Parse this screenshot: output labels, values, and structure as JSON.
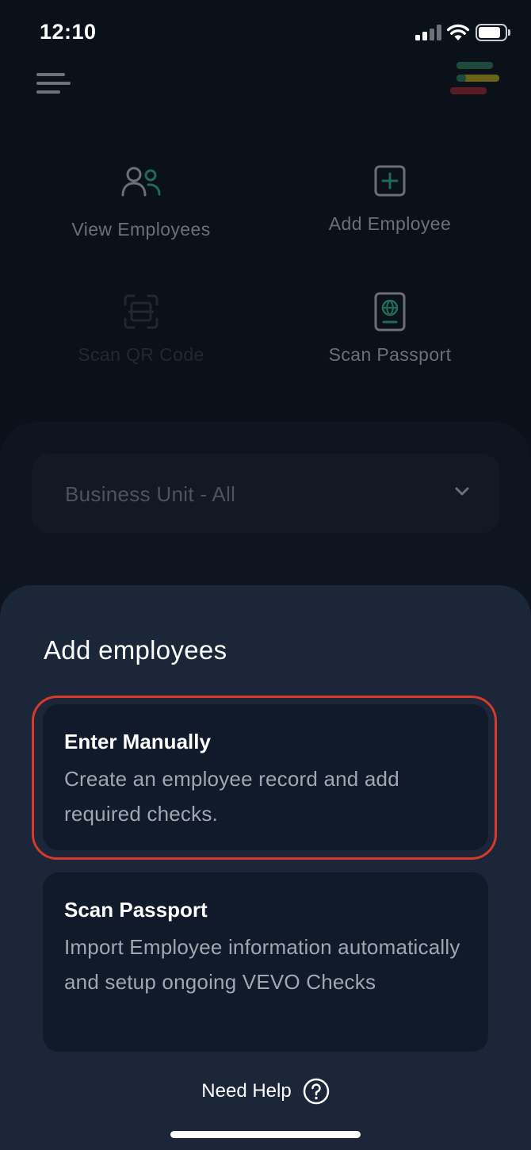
{
  "status_bar": {
    "time": "12:10"
  },
  "dashboard": {
    "tiles": [
      {
        "label": "View Employees",
        "icon": "users-icon"
      },
      {
        "label": "Add Employee",
        "icon": "add-square-icon"
      },
      {
        "label": "Scan QR Code",
        "icon": "qr-scan-icon"
      },
      {
        "label": "Scan Passport",
        "icon": "passport-icon"
      }
    ],
    "business_unit": {
      "value": "Business Unit - All",
      "icon": "chevron-down-icon"
    }
  },
  "sheet": {
    "title": "Add employees",
    "options": [
      {
        "title": "Enter Manually",
        "description": "Create an employee record and add required checks."
      },
      {
        "title": "Scan Passport",
        "description": "Import Employee information automatically and setup ongoing VEVO Checks"
      }
    ],
    "help_label": "Need Help",
    "highlight_color": "#d53a2a"
  },
  "colors": {
    "background": "#0b1119",
    "sheet": "#1b2638",
    "card": "#111a2a",
    "accent_green": "#1f6b55"
  }
}
